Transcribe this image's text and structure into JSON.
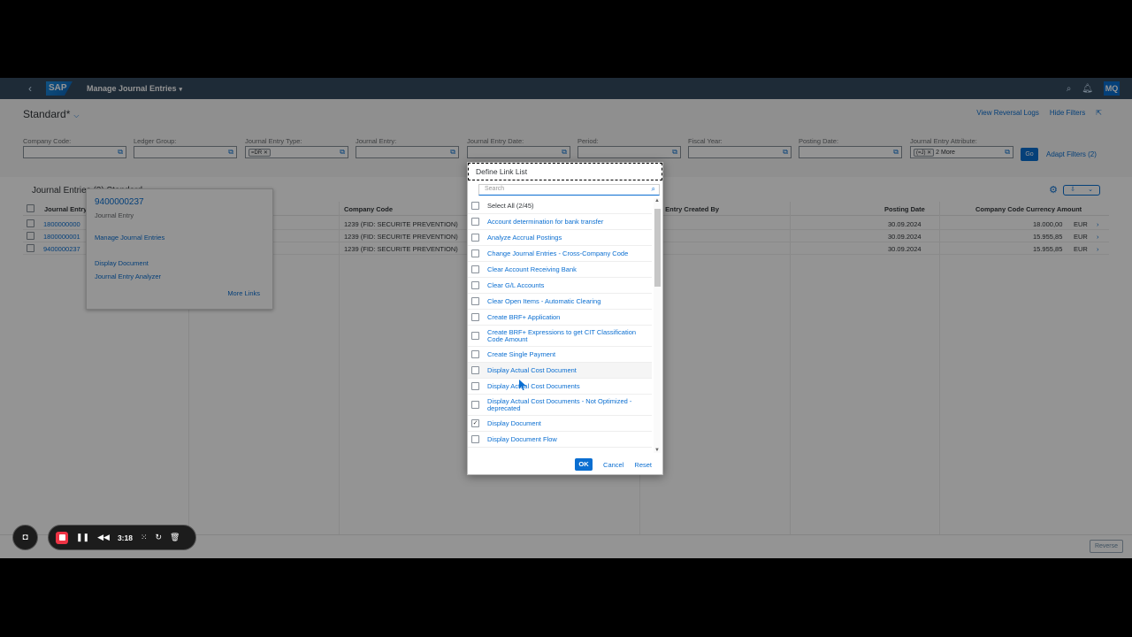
{
  "shell": {
    "app_title": "Manage Journal Entries",
    "logo": "SAP",
    "avatar": "MQ",
    "back_icon": "‹",
    "dropdown_glyph": "▾"
  },
  "header": {
    "variant": "Standard*",
    "links": [
      "View Reversal Logs",
      "Hide Filters"
    ],
    "filters": [
      {
        "label": "Company Code:",
        "value": ""
      },
      {
        "label": "Ledger Group:",
        "value": ""
      },
      {
        "label": "Journal Entry Type:",
        "value": "=DR"
      },
      {
        "label": "Journal Entry:",
        "value": ""
      },
      {
        "label": "Journal Entry Date:",
        "value": ""
      },
      {
        "label": "Period:",
        "value": ""
      },
      {
        "label": "Fiscal Year:",
        "value": ""
      },
      {
        "label": "Posting Date:",
        "value": ""
      },
      {
        "label": "Journal Entry Attribute:",
        "value": "(=J)",
        "more": "2 More"
      }
    ],
    "go": "Go",
    "adapt": "Adapt Filters (2)"
  },
  "table": {
    "title": "Journal Entries (3)  Standard",
    "columns": [
      "Journal Entry",
      "Company Code",
      "Journal Entry Created By",
      "Posting Date",
      "Company Code Currency Amount"
    ],
    "rows": [
      {
        "entry": "1800000000",
        "company": "1239 (FID: SECURITE PREVENTION)",
        "posting": "30.09.2024",
        "amount": "18.000,00",
        "currency": "EUR"
      },
      {
        "entry": "1800000001",
        "company": "1239 (FID: SECURITE PREVENTION)",
        "posting": "30.09.2024",
        "amount": "15.955,85",
        "currency": "EUR"
      },
      {
        "entry": "9400000237",
        "company": "1239 (FID: SECURITE PREVENTION)",
        "posting": "30.09.2024",
        "amount": "15.955,85",
        "currency": "EUR"
      }
    ],
    "reverse": "Reverse"
  },
  "popover": {
    "title": "9400000237",
    "subtitle": "Journal Entry",
    "links": [
      "Manage Journal Entries",
      "Display Document",
      "Journal Entry Analyzer"
    ],
    "more": "More Links"
  },
  "dialog": {
    "title": "Define Link List",
    "search_placeholder": "Search",
    "items": [
      {
        "label": "Select All (2/45)",
        "checked": false,
        "plain": true
      },
      {
        "label": "Account determination for bank transfer",
        "checked": false
      },
      {
        "label": "Analyze Accrual Postings",
        "checked": false
      },
      {
        "label": "Change Journal Entries - Cross-Company Code",
        "checked": false
      },
      {
        "label": "Clear Account Receiving Bank",
        "checked": false
      },
      {
        "label": "Clear G/L Accounts",
        "checked": false
      },
      {
        "label": "Clear Open Items - Automatic Clearing",
        "checked": false
      },
      {
        "label": "Create BRF+ Application",
        "checked": false
      },
      {
        "label": "Create BRF+ Expressions to get CIT Classification Code Amount",
        "checked": false
      },
      {
        "label": "Create Single Payment",
        "checked": false
      },
      {
        "label": "Display Actual Cost Document",
        "checked": false
      },
      {
        "label": "Display Actual Cost Documents",
        "checked": false
      },
      {
        "label": "Display Actual Cost Documents - Not Optimized - deprecated",
        "checked": false
      },
      {
        "label": "Display Document",
        "checked": true
      },
      {
        "label": "Display Document Flow",
        "checked": false
      }
    ],
    "ok": "OK",
    "cancel": "Cancel",
    "reset": "Reset"
  },
  "recorder": {
    "time": "3:18"
  }
}
